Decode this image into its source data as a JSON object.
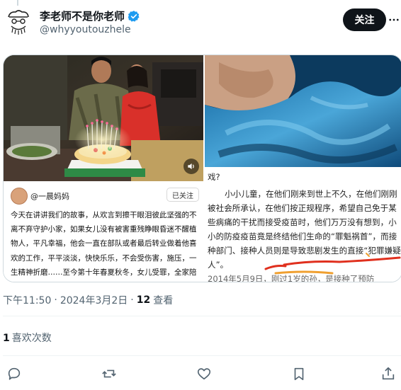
{
  "author": {
    "display_name": "李老师不是你老师",
    "handle": "@whyyoutouzhele",
    "verified": true
  },
  "header": {
    "follow_label": "关注"
  },
  "media": {
    "left_article": {
      "author_name": "@一晨妈妈",
      "followed_label": "已关注",
      "text": "今天在讲讲我们的故事，从欢言到擦干眼泪彼此坚强的不离不弃守护小家，如果女儿没有被害重残睁眼昏迷不醒植物人，平凡幸福，他会一直在部队或者最后转业做着他喜欢的工作，平平淡淡，快快乐乐，不会受伤害，施压，一生精神折磨……至今第十年春夏秋冬，女儿受罪，全家陪罪，人生有"
    },
    "right_doc": {
      "line1": "戏?",
      "paragraph": "小小儿童，在他们刚来到世上不久，在他们刚刚被社会所承认，在他们按正规程序，希望自己免于某些病痛的干扰而接受疫苗时，他们万万没有想到，小小的防疫疫苗竟是终结他们生命的“罪魁祸首”，而接种部门、接种人员则是导致悲剧发生的直接“犯罪嫌疑人”。",
      "tail": "2014年5月9日，刚过1岁的孙，是接种了预防"
    },
    "accent_colors": {
      "underline_red": "#e0301e",
      "underline_orange": "#f0a030"
    }
  },
  "meta": {
    "time": "下午11:50",
    "date": "2024年3月2日",
    "views_count": "12",
    "views_label": "查看",
    "separator": "·"
  },
  "likes": {
    "count": "1",
    "label": "喜欢次数"
  },
  "icons": {
    "reply": "reply-icon",
    "retweet": "retweet-icon",
    "like": "heart-icon",
    "bookmark": "bookmark-icon",
    "share": "share-icon",
    "more": "more-icon",
    "verified": "verified-badge-icon",
    "sound": "speaker-icon"
  },
  "colors": {
    "verified_blue": "#1d9bf0",
    "follow_button_bg": "#0f1419",
    "secondary_text": "#536471"
  }
}
